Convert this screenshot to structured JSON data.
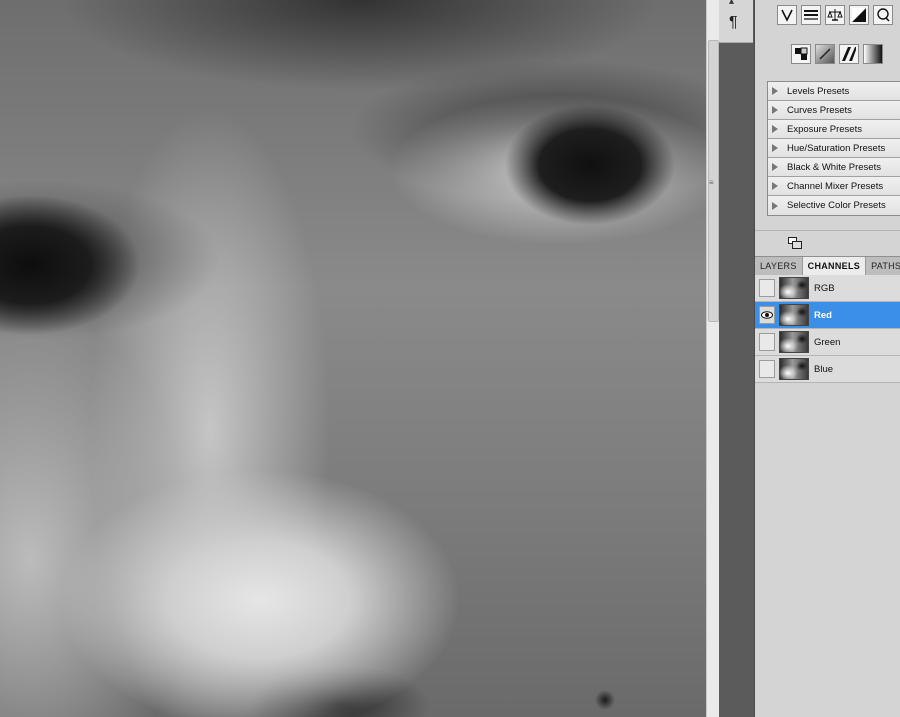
{
  "canvas": {
    "description_icon": "photo-canvas"
  },
  "dock": {
    "icons": [
      "character-icon",
      "paragraph-icon"
    ],
    "paragraph_glyph": "¶"
  },
  "adjustments": {
    "row1_icons": [
      "vibrance-icon",
      "color-balance-icon",
      "balance-scale-icon",
      "black-white-icon",
      "photo-filter-icon"
    ],
    "row2_icons": [
      "channel-mixer-icon",
      "invert-icon",
      "posterize-icon",
      "gradient-map-icon"
    ],
    "presets": [
      {
        "label": "Levels Presets"
      },
      {
        "label": "Curves Presets"
      },
      {
        "label": "Exposure Presets"
      },
      {
        "label": "Hue/Saturation Presets"
      },
      {
        "label": "Black & White Presets"
      },
      {
        "label": "Channel Mixer Presets"
      },
      {
        "label": "Selective Color Presets"
      }
    ]
  },
  "tabs": [
    {
      "label": "LAYERS",
      "active": false
    },
    {
      "label": "CHANNELS",
      "active": true
    },
    {
      "label": "PATHS",
      "active": false
    }
  ],
  "channels": [
    {
      "name": "RGB",
      "visible": false,
      "selected": false
    },
    {
      "name": "Red",
      "visible": true,
      "selected": true
    },
    {
      "name": "Green",
      "visible": false,
      "selected": false
    },
    {
      "name": "Blue",
      "visible": false,
      "selected": false
    }
  ],
  "colors": {
    "selection": "#3b8fe6",
    "panel_bg": "#d4d4d4",
    "dock_bg": "#5b5b5b"
  }
}
